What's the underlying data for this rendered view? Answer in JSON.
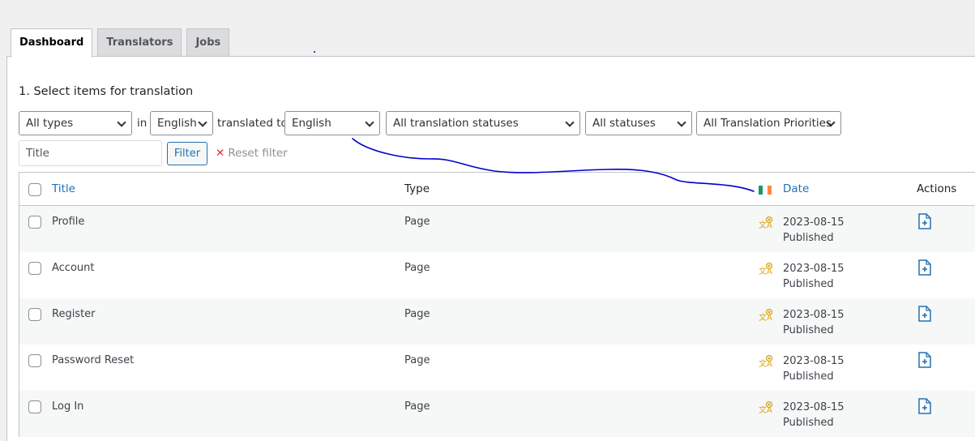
{
  "tabs": [
    {
      "label": "Dashboard",
      "active": true
    },
    {
      "label": "Translators",
      "active": false
    },
    {
      "label": "Jobs",
      "active": false
    }
  ],
  "section_title": "1. Select items for translation",
  "filters": {
    "type": "All types",
    "in_label": "in",
    "from_language": "English",
    "translated_to_label": "translated to",
    "to_language": "English",
    "translation_status": "All translation statuses",
    "status": "All statuses",
    "priority": "All Translation Priorities",
    "title_placeholder": "Title",
    "filter_button": "Filter",
    "reset_icon": "close-icon",
    "reset_label": "Reset filter"
  },
  "table": {
    "headers": {
      "title": "Title",
      "type": "Type",
      "date": "Date",
      "actions": "Actions"
    },
    "flag_colors": [
      "#169b62",
      "#ffffff",
      "#ff883e"
    ],
    "rows": [
      {
        "title": "Profile",
        "type": "Page",
        "date": "2023-08-15",
        "status": "Published"
      },
      {
        "title": "Account",
        "type": "Page",
        "date": "2023-08-15",
        "status": "Published"
      },
      {
        "title": "Register",
        "type": "Page",
        "date": "2023-08-15",
        "status": "Published"
      },
      {
        "title": "Password Reset",
        "type": "Page",
        "date": "2023-08-15",
        "status": "Published"
      },
      {
        "title": "Log In",
        "type": "Page",
        "date": "2023-08-15",
        "status": "Published"
      }
    ]
  },
  "colors": {
    "accent": "#2271b1",
    "annotation_stroke": "#0000cc",
    "translate_icon": "#dba617"
  }
}
